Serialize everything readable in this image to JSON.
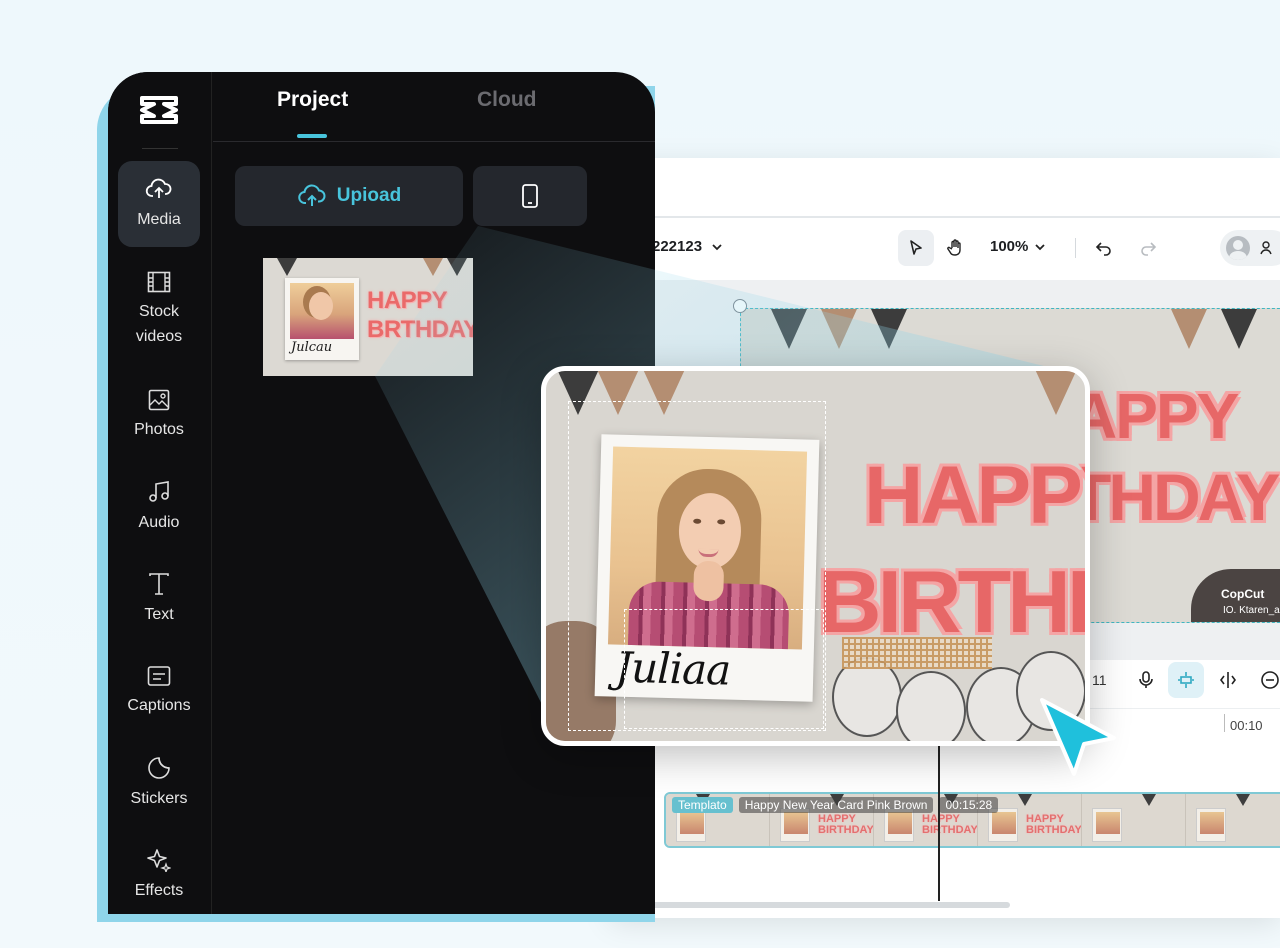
{
  "sidebar": {
    "items": [
      {
        "label": "Media",
        "icon": "cloud-upload-icon",
        "active": true
      },
      {
        "label": "Stock\nvideos",
        "icon": "film-icon"
      },
      {
        "label": "Photos",
        "icon": "image-icon"
      },
      {
        "label": "Audio",
        "icon": "music-note-icon"
      },
      {
        "label": "Text",
        "icon": "text-icon"
      },
      {
        "label": "Captions",
        "icon": "captions-icon"
      },
      {
        "label": "Stickers",
        "icon": "sticker-icon"
      },
      {
        "label": "Effects",
        "icon": "sparkle-icon"
      }
    ]
  },
  "tabs": {
    "project": "Project",
    "cloud": "Cloud"
  },
  "upload": {
    "label": "Upioad"
  },
  "thumbnail": {
    "title_line1": "HAPPY",
    "title_line2": "BRTHDAY",
    "signature": "Julcau"
  },
  "editor": {
    "project_name": "222123",
    "zoom": "100%",
    "timeline_counter": "11",
    "ruler_time": "00:10"
  },
  "preview": {
    "title_line1": "HAPPY",
    "title_line2": "BIRTHDA",
    "signature": "Juliaa"
  },
  "canvas": {
    "title_line1": "APPY",
    "title_line2": "THDAY",
    "brand": "CopCut",
    "sub": "IO. Ktaren_ann"
  },
  "clip": {
    "tag": "Templato",
    "name": "Happy New Year Card Pink Brown",
    "duration": "00:15:28",
    "frame_text_1": "HAPPY",
    "frame_text_2": "BIRTHDAY"
  },
  "colors": {
    "accent": "#48c4dc",
    "panel_bg": "#0e0e10",
    "title_pink": "#e76767"
  }
}
